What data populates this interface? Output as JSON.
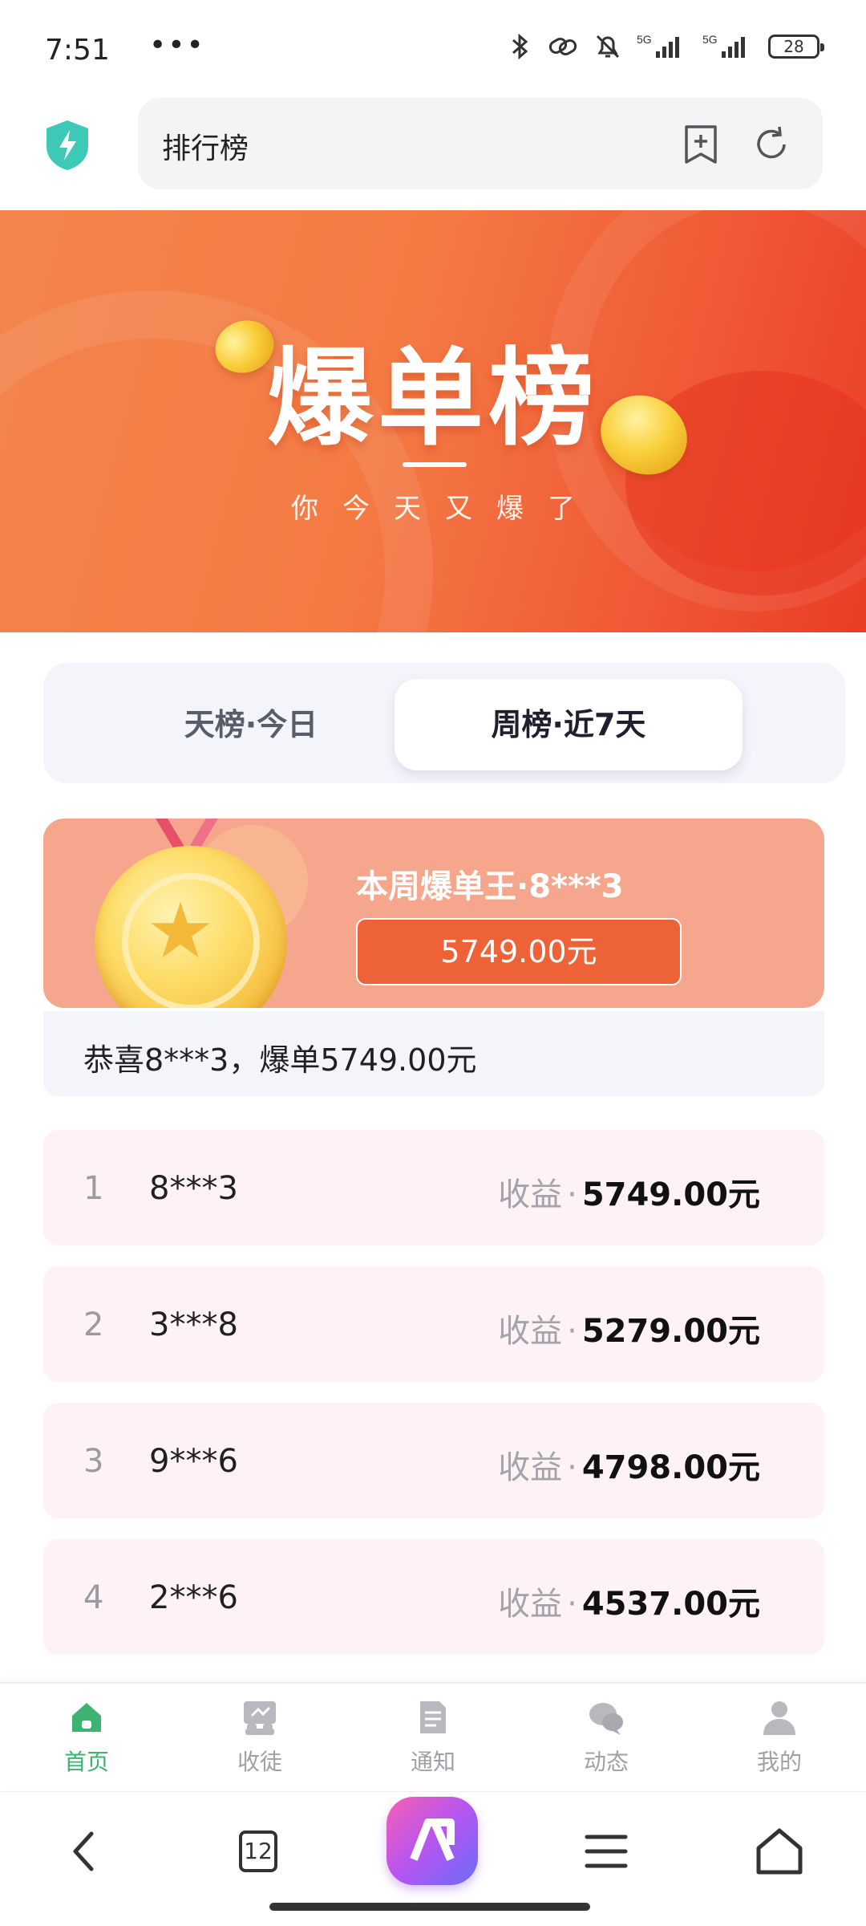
{
  "status_bar": {
    "time": "7:51",
    "dots": "•••",
    "battery": "28",
    "icons": [
      "bluetooth-icon",
      "link-icon",
      "mute-bell-icon",
      "signal-5g-icon",
      "signal-5g-icon"
    ]
  },
  "browser": {
    "page_title": "排行榜",
    "shield_icon": "shield-bolt-icon",
    "shield_color": "#3ec9b7"
  },
  "banner": {
    "title": "爆单榜",
    "subtitle": "你今天又爆了"
  },
  "tabs": [
    {
      "label": "天榜·今日",
      "active": false
    },
    {
      "label": "周榜·近7天",
      "active": true
    }
  ],
  "champion": {
    "title": "本周爆单王·8***3",
    "amount": "5749.00元"
  },
  "congrats": "恭喜8***3，爆单5749.00元",
  "ranking": {
    "income_label": "收益",
    "separator": "·",
    "rows": [
      {
        "rank": "1",
        "user": "8***3",
        "value": "5749.00元"
      },
      {
        "rank": "2",
        "user": "3***8",
        "value": "5279.00元"
      },
      {
        "rank": "3",
        "user": "9***6",
        "value": "4798.00元"
      },
      {
        "rank": "4",
        "user": "2***6",
        "value": "4537.00元"
      }
    ]
  },
  "app_nav": {
    "items": [
      {
        "label": "首页",
        "icon": "home-icon",
        "active": true
      },
      {
        "label": "收徒",
        "icon": "team-icon",
        "active": false
      },
      {
        "label": "通知",
        "icon": "notice-icon",
        "active": false
      },
      {
        "label": "动态",
        "icon": "chat-icon",
        "active": false
      },
      {
        "label": "我的",
        "icon": "user-icon",
        "active": false
      }
    ]
  },
  "toolbar": {
    "tab_count": "12"
  },
  "colors": {
    "accent_green": "#3cb371",
    "banner_orange": "#f47a44",
    "champion_bg": "#f5a68c",
    "amount_bg": "#ee6238",
    "row_bg": "#fff2f5"
  }
}
